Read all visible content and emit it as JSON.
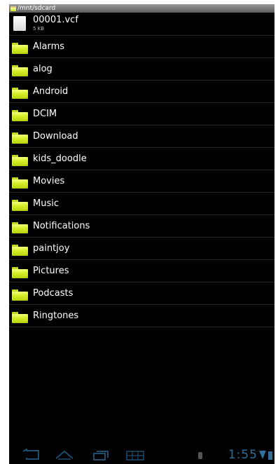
{
  "path": "/mnt/sdcard",
  "file": {
    "name": "00001.vcf",
    "size": "5 KB"
  },
  "folders": [
    "Alarms",
    "alog",
    "Android",
    "DCIM",
    "Download",
    "kids_doodle",
    "Movies",
    "Music",
    "Notifications",
    "paintjoy",
    "Pictures",
    "Podcasts",
    "Ringtones"
  ],
  "status": {
    "time": "1:55"
  },
  "icons": {
    "back": "back-icon",
    "home": "home-icon",
    "recent": "recent-apps-icon",
    "grid": "screenshot-icon",
    "usb": "usb-icon",
    "wifi": "wifi-icon",
    "battery": "battery-icon",
    "folder": "folder-icon",
    "file": "file-icon"
  },
  "colors": {
    "folder": "#d6ee2a",
    "nav": "#2f6f9a"
  }
}
